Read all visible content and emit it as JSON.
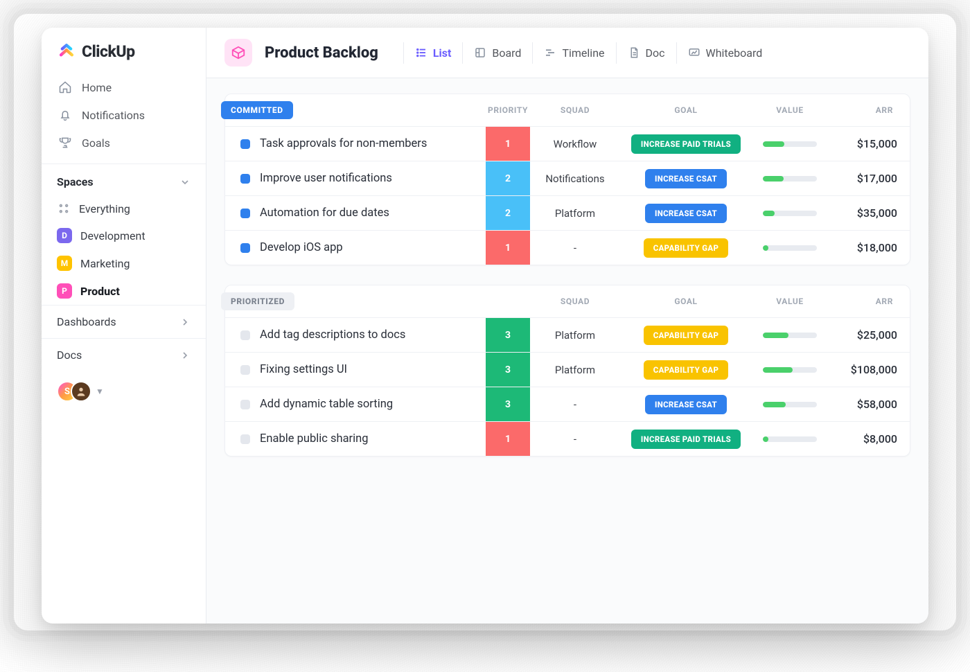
{
  "brand": {
    "name": "ClickUp"
  },
  "nav": {
    "home": "Home",
    "notifications": "Notifications",
    "goals": "Goals"
  },
  "spaces": {
    "heading": "Spaces",
    "everything": "Everything",
    "items": [
      {
        "letter": "D",
        "label": "Development",
        "color": "#7b68ee"
      },
      {
        "letter": "M",
        "label": "Marketing",
        "color": "#ffc300"
      },
      {
        "letter": "P",
        "label": "Product",
        "color": "#ff4fb8"
      }
    ]
  },
  "side": {
    "dashboards": "Dashboards",
    "docs": "Docs",
    "avatar_initial": "S"
  },
  "header": {
    "title": "Product Backlog",
    "views": {
      "list": "List",
      "board": "Board",
      "timeline": "Timeline",
      "doc": "Doc",
      "whiteboard": "Whiteboard"
    }
  },
  "columns": {
    "priority": "PRIORITY",
    "squad": "SQUAD",
    "goal": "GOAL",
    "value": "VALUE",
    "arr": "ARR"
  },
  "groups": [
    {
      "label": "COMMITTED",
      "pill": "blue",
      "status_color": "blue",
      "show_priority_header": true,
      "rows": [
        {
          "name": "Task approvals for non-members",
          "priority": "1",
          "prio_color": "red",
          "squad": "Workflow",
          "goal": "INCREASE PAID TRIALS",
          "goal_color": "gp-green",
          "value_pct": 40,
          "arr": "$15,000"
        },
        {
          "name": "Improve  user notifications",
          "priority": "2",
          "prio_color": "cyan",
          "squad": "Notifications",
          "goal": "INCREASE CSAT",
          "goal_color": "gp-blue",
          "value_pct": 38,
          "arr": "$17,000"
        },
        {
          "name": "Automation for due dates",
          "priority": "2",
          "prio_color": "cyan",
          "squad": "Platform",
          "goal": "INCREASE CSAT",
          "goal_color": "gp-blue",
          "value_pct": 22,
          "arr": "$35,000"
        },
        {
          "name": "Develop iOS app",
          "priority": "1",
          "prio_color": "red",
          "squad": "-",
          "goal": "CAPABILITY GAP",
          "goal_color": "gp-yellow",
          "value_pct": 10,
          "arr": "$18,000"
        }
      ]
    },
    {
      "label": "PRIORITIZED",
      "pill": "grey",
      "status_color": "grey",
      "show_priority_header": false,
      "rows": [
        {
          "name": "Add tag descriptions to docs",
          "priority": "3",
          "prio_color": "green",
          "squad": "Platform",
          "goal": "CAPABILITY GAP",
          "goal_color": "gp-yellow",
          "value_pct": 48,
          "arr": "$25,000"
        },
        {
          "name": "Fixing settings UI",
          "priority": "3",
          "prio_color": "green",
          "squad": "Platform",
          "goal": "CAPABILITY GAP",
          "goal_color": "gp-yellow",
          "value_pct": 55,
          "arr": "$108,000"
        },
        {
          "name": "Add dynamic table sorting",
          "priority": "3",
          "prio_color": "green",
          "squad": "-",
          "goal": "INCREASE CSAT",
          "goal_color": "gp-blue",
          "value_pct": 42,
          "arr": "$58,000"
        },
        {
          "name": "Enable public sharing",
          "priority": "1",
          "prio_color": "red",
          "squad": "-",
          "goal": "INCREASE PAID TRIALS",
          "goal_color": "gp-green",
          "value_pct": 10,
          "arr": "$8,000"
        }
      ]
    }
  ]
}
